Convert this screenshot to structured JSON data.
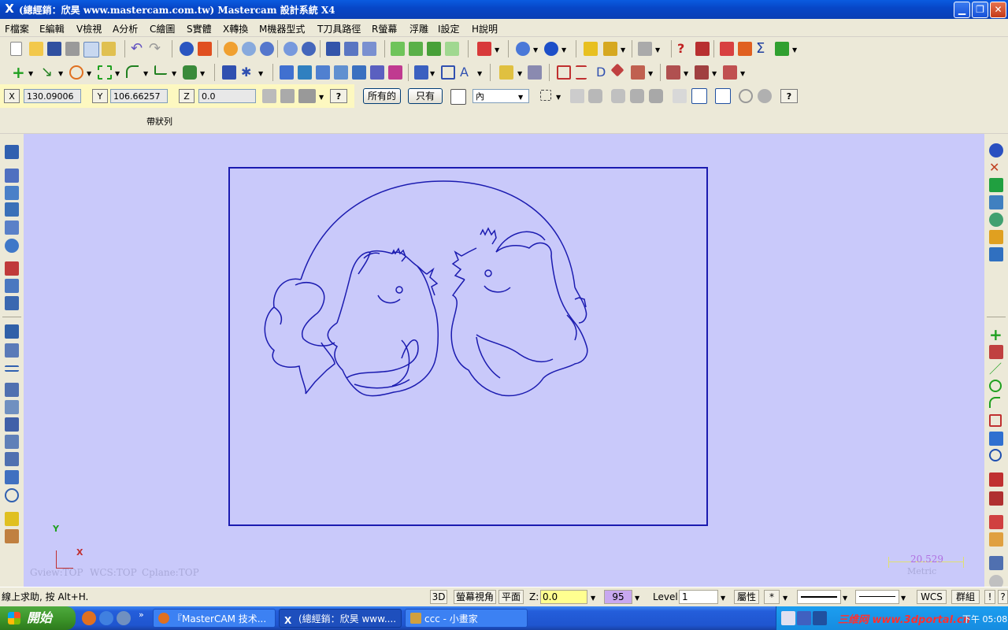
{
  "window": {
    "title": "(總經銷：欣昊 www.mastercam.com.tw) Mastercam 設計系統 X4",
    "min_glyph": "▁",
    "max_glyph": "❐",
    "close_glyph": "✕"
  },
  "menu": [
    "F檔案",
    "E編輯",
    "V檢視",
    "A分析",
    "C繪圖",
    "S實體",
    "X轉換",
    "M機器型式",
    "T刀具路徑",
    "R螢幕",
    "浮雕",
    "I設定",
    "H說明"
  ],
  "ribbon": {
    "x_label": "X",
    "x_value": "130.09006",
    "y_label": "Y",
    "y_value": "106.66257",
    "z_label": "Z",
    "z_value": "0.0",
    "help_glyph": "?",
    "all_button": "所有的",
    "only_button": "只有",
    "mode_value": "內"
  },
  "subbar_label": "帶狀列",
  "viewport": {
    "gview": "Gview:TOP",
    "wcs": "WCS:TOP",
    "cplane": "Cplane:TOP",
    "axis_x": "X",
    "axis_y": "Y",
    "scale_value": "20.529",
    "scale_unit": "Metric"
  },
  "status": {
    "hint": "線上求助, 按 Alt+H.",
    "btn_3d": "3D",
    "screen_view": "螢幕視角",
    "plane": "平面",
    "z_label": "Z:",
    "z_value": "0.0",
    "color_value": "95",
    "level_label": "Level:",
    "level_value": "1",
    "attributes": "屬性",
    "point_style": "*",
    "wcs": "WCS",
    "group": "群組",
    "bang": "!",
    "question": "?"
  },
  "taskbar": {
    "start": "開始",
    "tasks": [
      "『MasterCAM 技术...",
      "(總經銷：欣昊 www....",
      "ccc - 小畫家"
    ],
    "watermark": "三维网 www.3dportal.cn",
    "clock": "下午 05:08"
  },
  "colors": {
    "viewport_bg": "#c9c9fa",
    "geometry": "#1b1bb0",
    "titlebar": "#0747c8",
    "taskbar": "#245edb"
  }
}
